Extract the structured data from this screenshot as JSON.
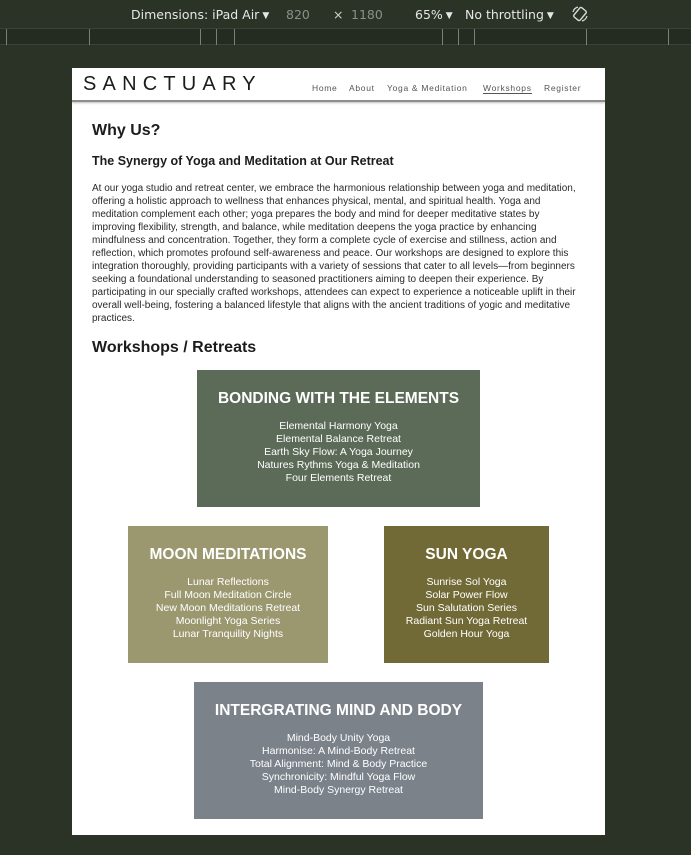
{
  "devtools": {
    "dimensions_label": "Dimensions: iPad Air",
    "width": "820",
    "times": "×",
    "height": "1180",
    "zoom": "65%",
    "throttling": "No throttling"
  },
  "site": {
    "logo": "SANCTUARY",
    "nav": [
      "Home",
      "About",
      "Yoga & Meditation",
      "Workshops",
      "Register"
    ],
    "active_nav": "Workshops"
  },
  "why": {
    "heading": "Why Us?",
    "subheading": "The Synergy of Yoga and Meditation at Our Retreat",
    "paragraph": "At our yoga studio and retreat center, we embrace the harmonious relationship between yoga and meditation, offering a holistic approach to wellness that enhances physical, mental, and spiritual health. Yoga and meditation complement each other; yoga prepares the body and mind for deeper meditative states by improving flexibility, strength, and balance, while meditation deepens the yoga practice by enhancing mindfulness and concentration. Together, they form a complete cycle of exercise and stillness, action and reflection, which promotes profound self-awareness and peace. Our workshops are designed to explore this integration thoroughly, providing participants with a variety of sessions that cater to all levels—from beginners seeking a foundational understanding to seasoned practitioners aiming to deepen their experience. By participating in our specially crafted workshops, attendees can expect to experience a noticeable uplift in their overall well-being, fostering a balanced lifestyle that aligns with the ancient traditions of yogic and meditative practices."
  },
  "workshops": {
    "heading": "Workshops / Retreats",
    "cards": [
      {
        "title": "BONDING WITH THE ELEMENTS",
        "color": "#5c6a58",
        "items": [
          "Elemental Harmony Yoga",
          "Elemental Balance Retreat",
          "Earth Sky Flow: A Yoga Journey",
          "Natures Rythms Yoga & Meditation",
          "Four Elements Retreat"
        ]
      },
      {
        "title": "MOON MEDITATIONS",
        "color": "#9b9870",
        "items": [
          "Lunar Reflections",
          "Full Moon Meditation Circle",
          "New Moon Meditations Retreat",
          "Moonlight Yoga Series",
          "Lunar Tranquility Nights"
        ]
      },
      {
        "title": "SUN YOGA",
        "color": "#726a36",
        "items": [
          "Sunrise Sol Yoga",
          "Solar Power Flow",
          "Sun Salutation Series",
          "Radiant Sun Yoga Retreat",
          "Golden Hour Yoga"
        ]
      },
      {
        "title": "INTERGRATING MIND AND BODY",
        "color": "#7b828a",
        "items": [
          "Mind-Body Unity Yoga",
          "Harmonise: A Mind-Body Retreat",
          "Total Alignment: Mind & Body Practice",
          "Synchronicity: Mindful Yoga Flow",
          "Mind-Body Synergy Retreat"
        ]
      }
    ]
  }
}
